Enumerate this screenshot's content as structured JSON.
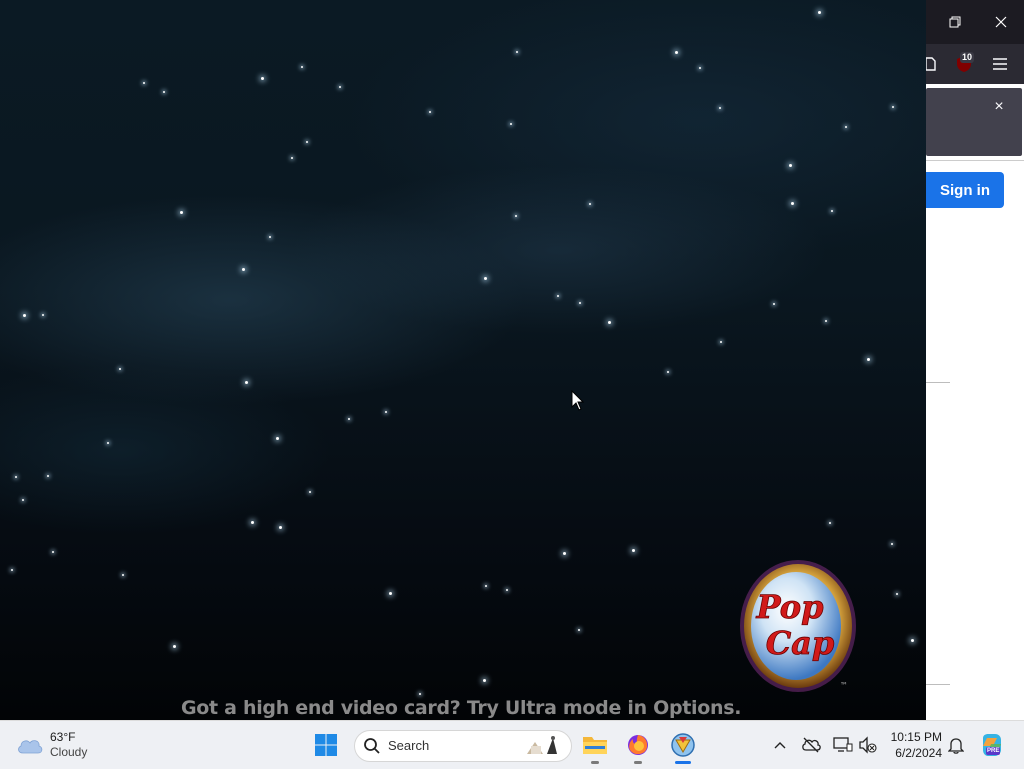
{
  "game": {
    "hint_text": "Got a high end video card? Try Ultra mode in Options.",
    "logo_text": "PopCap",
    "logo_tm": "™"
  },
  "browser": {
    "extension_badge": "10",
    "sign_in_label": "Sign in",
    "notice_close": "×"
  },
  "taskbar": {
    "weather_temp": "63°F",
    "weather_condition": "Cloudy",
    "search_placeholder": "Search",
    "clock_time": "10:15 PM",
    "clock_date": "6/2/2024",
    "copilot_badge": "PRE"
  }
}
